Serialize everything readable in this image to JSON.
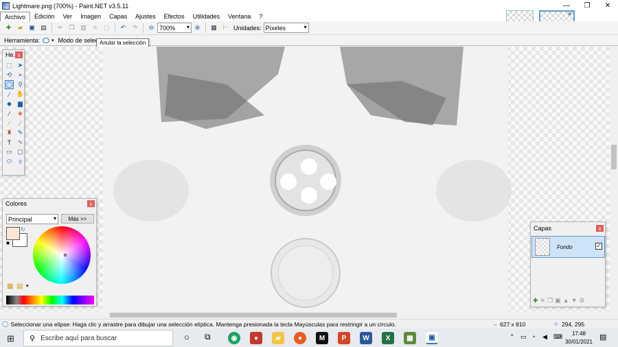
{
  "window": {
    "title": "Lightmare.png (700%) - Paint.NET v3.5.11",
    "controls": {
      "minimize": "—",
      "maximize": "❐",
      "close": "✕"
    }
  },
  "menu": [
    "Archivo",
    "Edición",
    "Ver",
    "Imagen",
    "Capas",
    "Ajustes",
    "Efectos",
    "Utilidades",
    "Ventana",
    "?"
  ],
  "toolbar": {
    "zoom_value": "700%",
    "units_label": "Unidades:",
    "units_value": "Píxeles"
  },
  "options": {
    "tool_label": "Herramienta:",
    "mode_label": "Modo de selecc",
    "tooltip": "Anular la selección"
  },
  "tools_window": {
    "title": "He...",
    "close": "x"
  },
  "colors_window": {
    "title": "Colores",
    "close": "x",
    "primary_select": "Principal",
    "more_button": "Más >>"
  },
  "layers_window": {
    "title": "Capas",
    "close": "x",
    "layer_name": "Fondo"
  },
  "status": {
    "hint": "Seleccionar una elipse: Haga clic y arrastre para dibujar una selección elíptica. Mantenga presionada la tecla Mayúsculas para restringir a un círculo.",
    "image_size": "627 x 810",
    "cursor_pos": "294, 295"
  },
  "taskbar": {
    "search_placeholder": "Escribe aquí para buscar",
    "time": "17:48",
    "date": "30/01/2021"
  },
  "colors": {
    "accent": "#3a78c2",
    "primary_color": "#fbe7d8",
    "secondary_color": "#ffffff"
  }
}
